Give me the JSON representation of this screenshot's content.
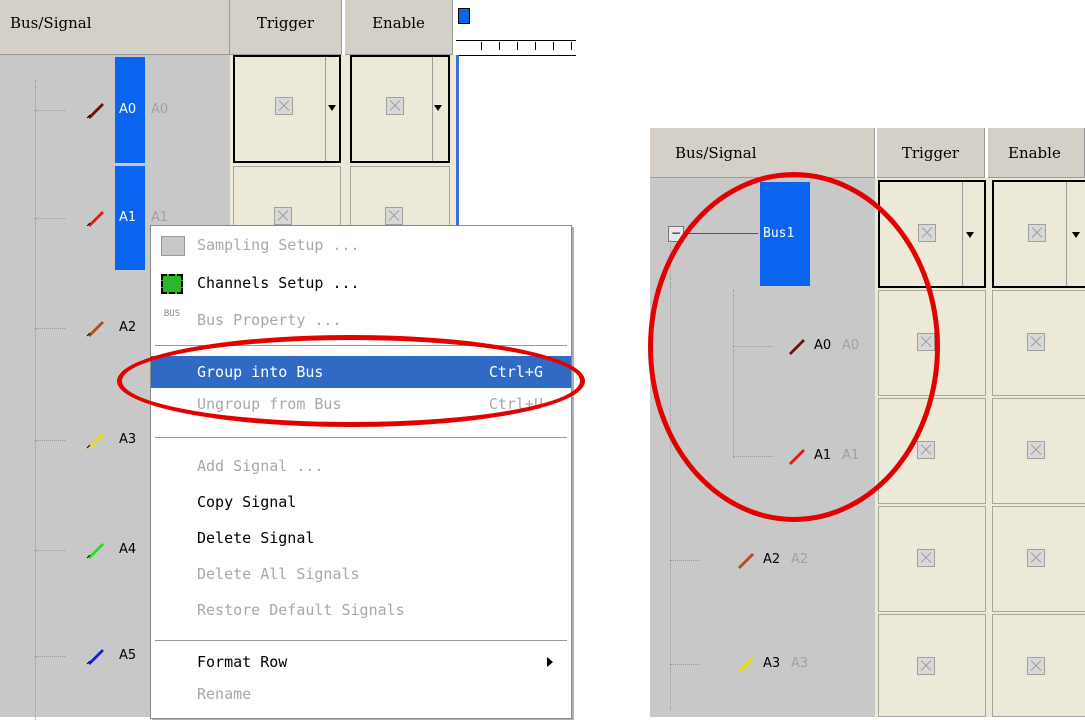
{
  "left": {
    "headers": {
      "bus_signal": "Bus/Signal",
      "trigger": "Trigger",
      "enable": "Enable"
    },
    "signals": [
      {
        "name": "A0",
        "alias": "A0",
        "color": "#6e0f0f"
      },
      {
        "name": "A1",
        "alias": "A1",
        "color": "#e01818"
      },
      {
        "name": "A2",
        "alias": "",
        "color": "#b34a18"
      },
      {
        "name": "A3",
        "alias": "",
        "color": "#f0e000"
      },
      {
        "name": "A4",
        "alias": "",
        "color": "#20e020"
      },
      {
        "name": "A5",
        "alias": "",
        "color": "#1020e0"
      }
    ],
    "context_menu": {
      "items": [
        {
          "label": "Sampling Setup ...",
          "shortcut": "",
          "disabled": true,
          "icon": "sampling-setup-icon"
        },
        {
          "label": "Channels Setup ...",
          "shortcut": "",
          "disabled": false,
          "icon": "channels-setup-icon"
        },
        {
          "label": "Bus Property ...",
          "shortcut": "",
          "disabled": true,
          "icon": "bus-property-icon"
        },
        {
          "label": "Group into Bus",
          "shortcut": "Ctrl+G",
          "disabled": false,
          "highlighted": true
        },
        {
          "label": "Ungroup from Bus",
          "shortcut": "Ctrl+U",
          "disabled": true
        },
        {
          "label": "Add Signal ...",
          "shortcut": "",
          "disabled": true
        },
        {
          "label": "Copy Signal",
          "shortcut": "",
          "disabled": false
        },
        {
          "label": "Delete Signal",
          "shortcut": "",
          "disabled": false
        },
        {
          "label": "Delete All Signals",
          "shortcut": "",
          "disabled": true
        },
        {
          "label": "Restore Default Signals",
          "shortcut": "",
          "disabled": true
        },
        {
          "label": "Format Row",
          "shortcut": "",
          "disabled": false,
          "submenu": true
        },
        {
          "label": "Rename",
          "shortcut": "",
          "disabled": true
        }
      ],
      "bus_icon_text": "BUS"
    }
  },
  "right": {
    "headers": {
      "bus_signal": "Bus/Signal",
      "trigger": "Trigger",
      "enable": "Enable"
    },
    "bus": {
      "name": "Bus1",
      "expander": "−"
    },
    "signals": [
      {
        "name": "A0",
        "alias": "A0",
        "color": "#6e0f0f"
      },
      {
        "name": "A1",
        "alias": "A1",
        "color": "#e01818"
      },
      {
        "name": "A2",
        "alias": "A2",
        "color": "#b34a18"
      },
      {
        "name": "A3",
        "alias": "A3",
        "color": "#f0e000"
      }
    ]
  },
  "colors": {
    "selection_blue": "#0a64f0",
    "menu_highlight": "#316ac5",
    "annotation_red": "#e30000"
  }
}
